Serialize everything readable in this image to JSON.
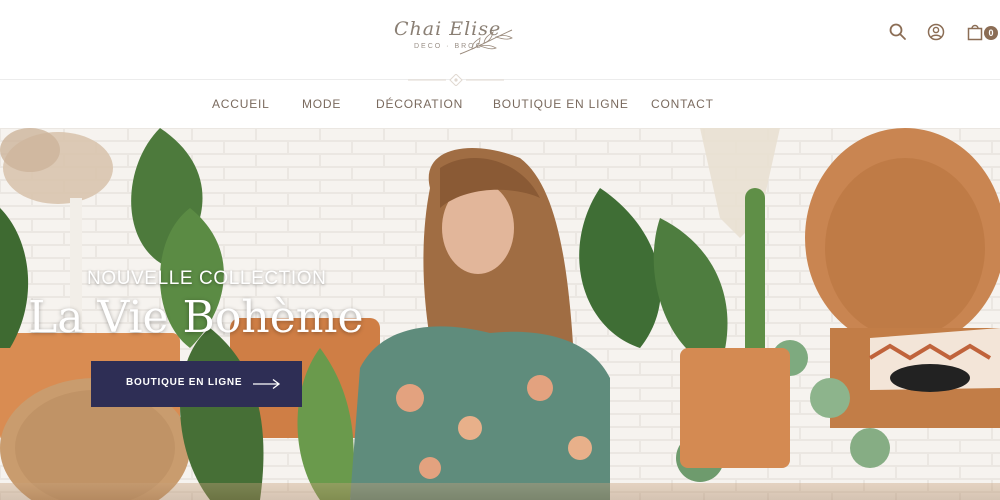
{
  "logo": {
    "script": "Chai Elise",
    "tagline": "DECO · BROC"
  },
  "header": {
    "icons": [
      "search-icon",
      "user-icon",
      "shopping-bag-icon"
    ],
    "cart_count": "0"
  },
  "nav": {
    "items": [
      {
        "label": "ACCUEIL"
      },
      {
        "label": "MODE"
      },
      {
        "label": "DÉCORATION"
      },
      {
        "label": "BOUTIQUE EN LIGNE"
      },
      {
        "label": "CONTACT"
      }
    ]
  },
  "hero": {
    "kicker": "NOUVELLE COLLECTION",
    "title": "La Vie Bohème",
    "cta_label": "BOUTIQUE EN LIGNE",
    "cta_icon": "arrow-right-icon"
  },
  "colors": {
    "accent_button": "#2e2e55",
    "nav_text": "#7a6a5e",
    "brand_brown": "#8b6d55"
  }
}
